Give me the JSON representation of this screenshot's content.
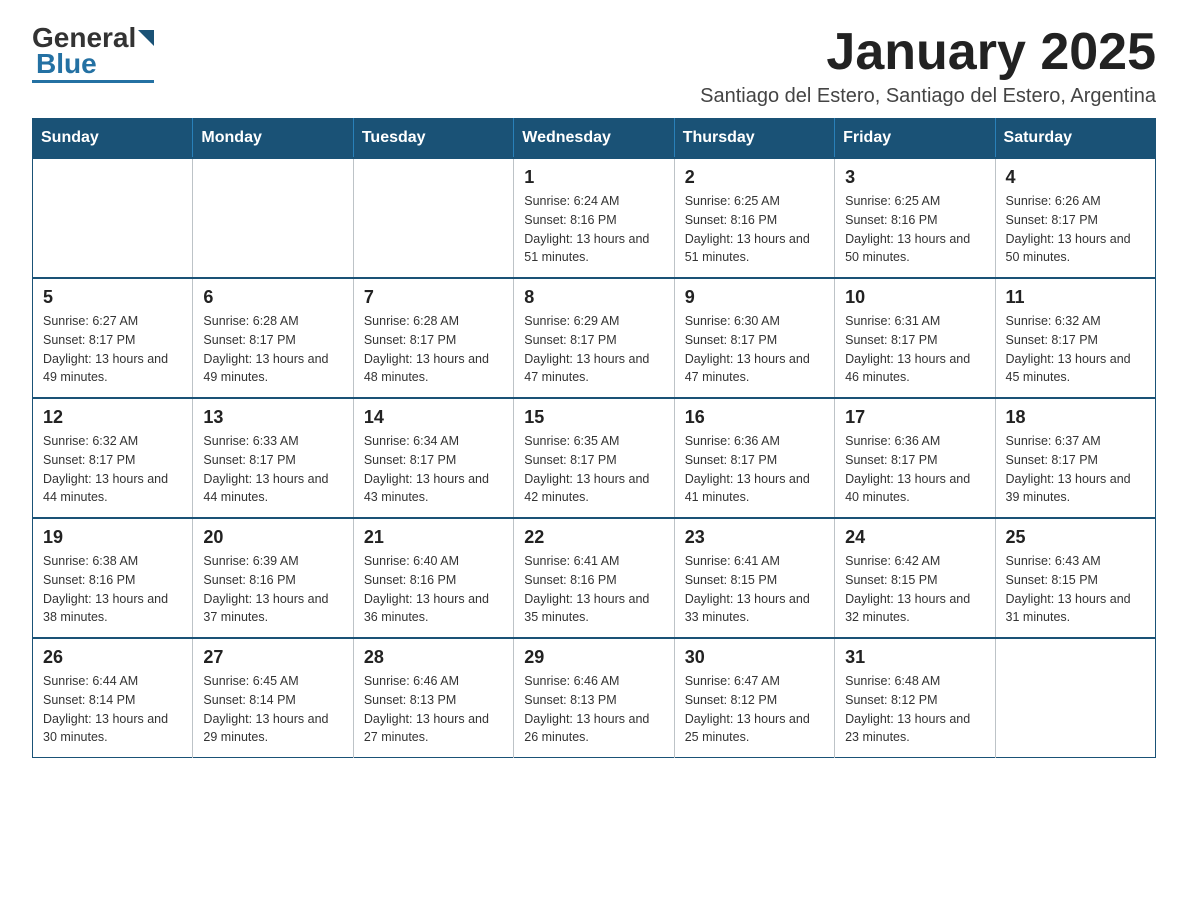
{
  "logo": {
    "general": "General",
    "blue": "Blue"
  },
  "header": {
    "title": "January 2025",
    "subtitle": "Santiago del Estero, Santiago del Estero, Argentina"
  },
  "weekdays": [
    "Sunday",
    "Monday",
    "Tuesday",
    "Wednesday",
    "Thursday",
    "Friday",
    "Saturday"
  ],
  "weeks": [
    [
      {
        "day": "",
        "info": ""
      },
      {
        "day": "",
        "info": ""
      },
      {
        "day": "",
        "info": ""
      },
      {
        "day": "1",
        "info": "Sunrise: 6:24 AM\nSunset: 8:16 PM\nDaylight: 13 hours\nand 51 minutes."
      },
      {
        "day": "2",
        "info": "Sunrise: 6:25 AM\nSunset: 8:16 PM\nDaylight: 13 hours\nand 51 minutes."
      },
      {
        "day": "3",
        "info": "Sunrise: 6:25 AM\nSunset: 8:16 PM\nDaylight: 13 hours\nand 50 minutes."
      },
      {
        "day": "4",
        "info": "Sunrise: 6:26 AM\nSunset: 8:17 PM\nDaylight: 13 hours\nand 50 minutes."
      }
    ],
    [
      {
        "day": "5",
        "info": "Sunrise: 6:27 AM\nSunset: 8:17 PM\nDaylight: 13 hours\nand 49 minutes."
      },
      {
        "day": "6",
        "info": "Sunrise: 6:28 AM\nSunset: 8:17 PM\nDaylight: 13 hours\nand 49 minutes."
      },
      {
        "day": "7",
        "info": "Sunrise: 6:28 AM\nSunset: 8:17 PM\nDaylight: 13 hours\nand 48 minutes."
      },
      {
        "day": "8",
        "info": "Sunrise: 6:29 AM\nSunset: 8:17 PM\nDaylight: 13 hours\nand 47 minutes."
      },
      {
        "day": "9",
        "info": "Sunrise: 6:30 AM\nSunset: 8:17 PM\nDaylight: 13 hours\nand 47 minutes."
      },
      {
        "day": "10",
        "info": "Sunrise: 6:31 AM\nSunset: 8:17 PM\nDaylight: 13 hours\nand 46 minutes."
      },
      {
        "day": "11",
        "info": "Sunrise: 6:32 AM\nSunset: 8:17 PM\nDaylight: 13 hours\nand 45 minutes."
      }
    ],
    [
      {
        "day": "12",
        "info": "Sunrise: 6:32 AM\nSunset: 8:17 PM\nDaylight: 13 hours\nand 44 minutes."
      },
      {
        "day": "13",
        "info": "Sunrise: 6:33 AM\nSunset: 8:17 PM\nDaylight: 13 hours\nand 44 minutes."
      },
      {
        "day": "14",
        "info": "Sunrise: 6:34 AM\nSunset: 8:17 PM\nDaylight: 13 hours\nand 43 minutes."
      },
      {
        "day": "15",
        "info": "Sunrise: 6:35 AM\nSunset: 8:17 PM\nDaylight: 13 hours\nand 42 minutes."
      },
      {
        "day": "16",
        "info": "Sunrise: 6:36 AM\nSunset: 8:17 PM\nDaylight: 13 hours\nand 41 minutes."
      },
      {
        "day": "17",
        "info": "Sunrise: 6:36 AM\nSunset: 8:17 PM\nDaylight: 13 hours\nand 40 minutes."
      },
      {
        "day": "18",
        "info": "Sunrise: 6:37 AM\nSunset: 8:17 PM\nDaylight: 13 hours\nand 39 minutes."
      }
    ],
    [
      {
        "day": "19",
        "info": "Sunrise: 6:38 AM\nSunset: 8:16 PM\nDaylight: 13 hours\nand 38 minutes."
      },
      {
        "day": "20",
        "info": "Sunrise: 6:39 AM\nSunset: 8:16 PM\nDaylight: 13 hours\nand 37 minutes."
      },
      {
        "day": "21",
        "info": "Sunrise: 6:40 AM\nSunset: 8:16 PM\nDaylight: 13 hours\nand 36 minutes."
      },
      {
        "day": "22",
        "info": "Sunrise: 6:41 AM\nSunset: 8:16 PM\nDaylight: 13 hours\nand 35 minutes."
      },
      {
        "day": "23",
        "info": "Sunrise: 6:41 AM\nSunset: 8:15 PM\nDaylight: 13 hours\nand 33 minutes."
      },
      {
        "day": "24",
        "info": "Sunrise: 6:42 AM\nSunset: 8:15 PM\nDaylight: 13 hours\nand 32 minutes."
      },
      {
        "day": "25",
        "info": "Sunrise: 6:43 AM\nSunset: 8:15 PM\nDaylight: 13 hours\nand 31 minutes."
      }
    ],
    [
      {
        "day": "26",
        "info": "Sunrise: 6:44 AM\nSunset: 8:14 PM\nDaylight: 13 hours\nand 30 minutes."
      },
      {
        "day": "27",
        "info": "Sunrise: 6:45 AM\nSunset: 8:14 PM\nDaylight: 13 hours\nand 29 minutes."
      },
      {
        "day": "28",
        "info": "Sunrise: 6:46 AM\nSunset: 8:13 PM\nDaylight: 13 hours\nand 27 minutes."
      },
      {
        "day": "29",
        "info": "Sunrise: 6:46 AM\nSunset: 8:13 PM\nDaylight: 13 hours\nand 26 minutes."
      },
      {
        "day": "30",
        "info": "Sunrise: 6:47 AM\nSunset: 8:12 PM\nDaylight: 13 hours\nand 25 minutes."
      },
      {
        "day": "31",
        "info": "Sunrise: 6:48 AM\nSunset: 8:12 PM\nDaylight: 13 hours\nand 23 minutes."
      },
      {
        "day": "",
        "info": ""
      }
    ]
  ]
}
